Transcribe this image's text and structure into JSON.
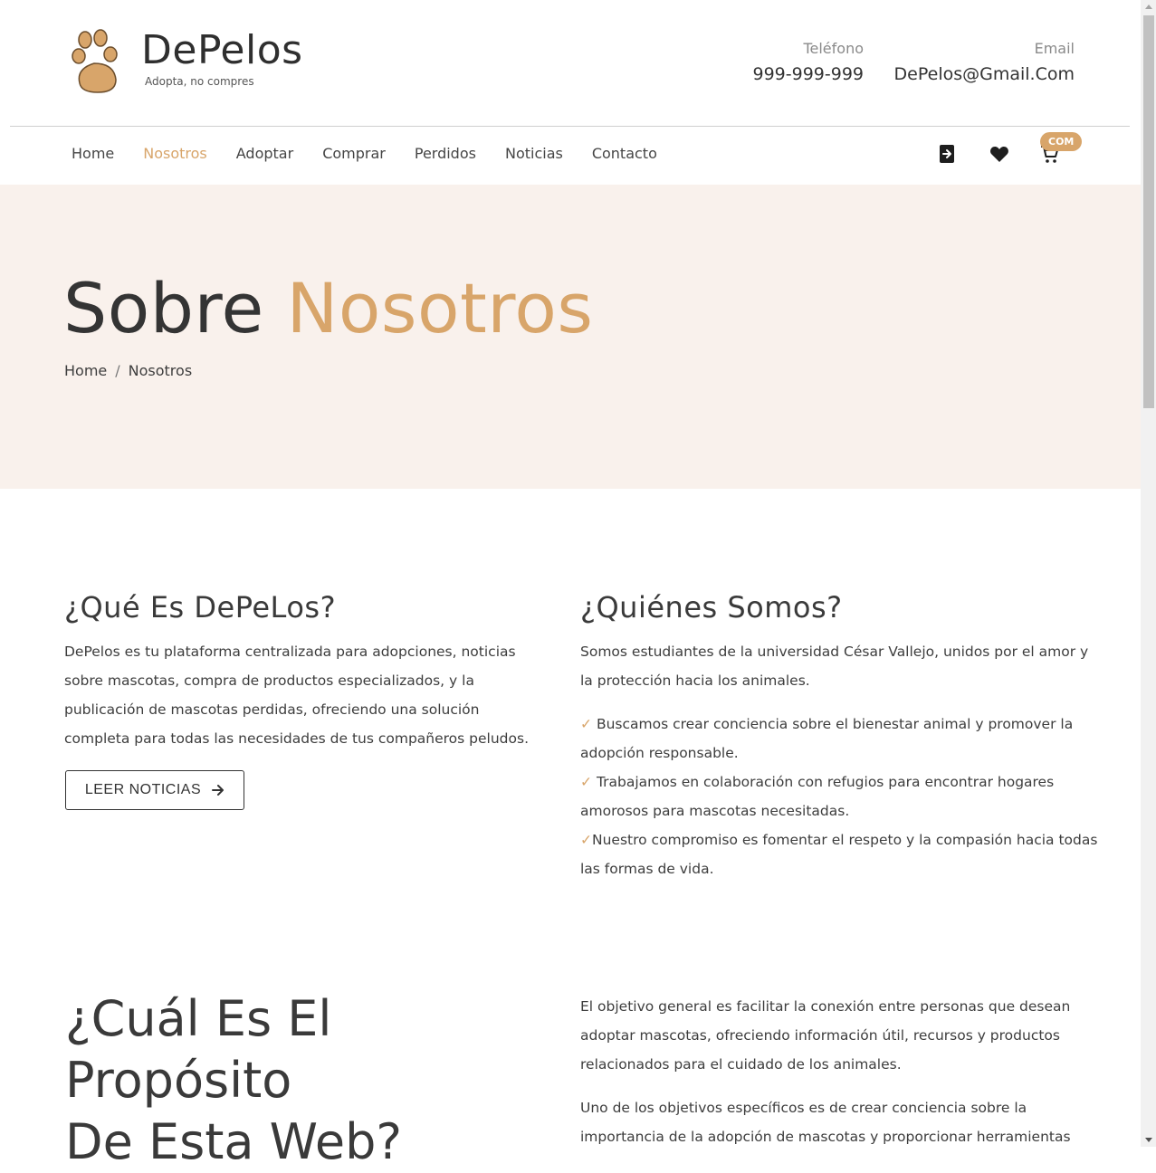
{
  "header": {
    "brand": "DePelos",
    "tagline": "Adopta, no compres",
    "phone_label": "Teléfono",
    "phone_value": "999-999-999",
    "email_label": "Email",
    "email_value": "DePelos@Gmail.Com"
  },
  "nav": {
    "items": [
      "Home",
      "Nosotros",
      "Adoptar",
      "Comprar",
      "Perdidos",
      "Noticias",
      "Contacto"
    ],
    "active": "Nosotros",
    "cart_badge": "COM",
    "icons": [
      "login-icon",
      "heart-icon",
      "cart-icon"
    ]
  },
  "hero": {
    "title_main": "Sobre",
    "title_accent": "Nosotros",
    "breadcrumb": [
      "Home",
      "/",
      "Nosotros"
    ]
  },
  "about": {
    "heading": "¿Qué Es DePeLos?",
    "lines": [
      "DePelos es tu plataforma centralizada para adopciones, noticias",
      "sobre mascotas, compra de productos especializados, y la",
      "publicación de mascotas perdidas, ofreciendo una solución",
      "completa para todas las necesidades de tus compañeros peludos."
    ],
    "button_label": "LEER NOTICIAS"
  },
  "who": {
    "heading": "¿Quiénes Somos?",
    "intro_lines": [
      "Somos estudiantes de la universidad César Vallejo, unidos por el amor y",
      "la protección hacia los animales."
    ],
    "checkmark": "✓",
    "points": [
      [
        "Buscamos crear conciencia sobre el bienestar animal y promover la",
        "adopción responsable."
      ],
      [
        "Trabajamos en colaboración con refugios para encontrar hogares",
        "amorosos para mascotas necesitadas."
      ],
      [
        "Nuestro compromiso es fomentar el respeto y la compasión hacia todas",
        "las formas de vida."
      ]
    ]
  },
  "purpose": {
    "heading_line1": "¿Cuál Es El Propósito",
    "heading_line2": "De Esta Web?",
    "para1_lines": [
      "El objetivo general es facilitar la conexión entre personas que desean",
      "adoptar mascotas, ofreciendo información útil, recursos y productos",
      "relacionados para el cuidado de los animales."
    ],
    "para2_lines": [
      "Uno de los objetivos específicos es de crear conciencia sobre la",
      "importancia de la adopción de mascotas y proporcionar herramientas"
    ]
  },
  "colors": {
    "accent": "#d8a56a",
    "hero_bg": "#f9f1ec",
    "text": "#3a3a3a"
  }
}
